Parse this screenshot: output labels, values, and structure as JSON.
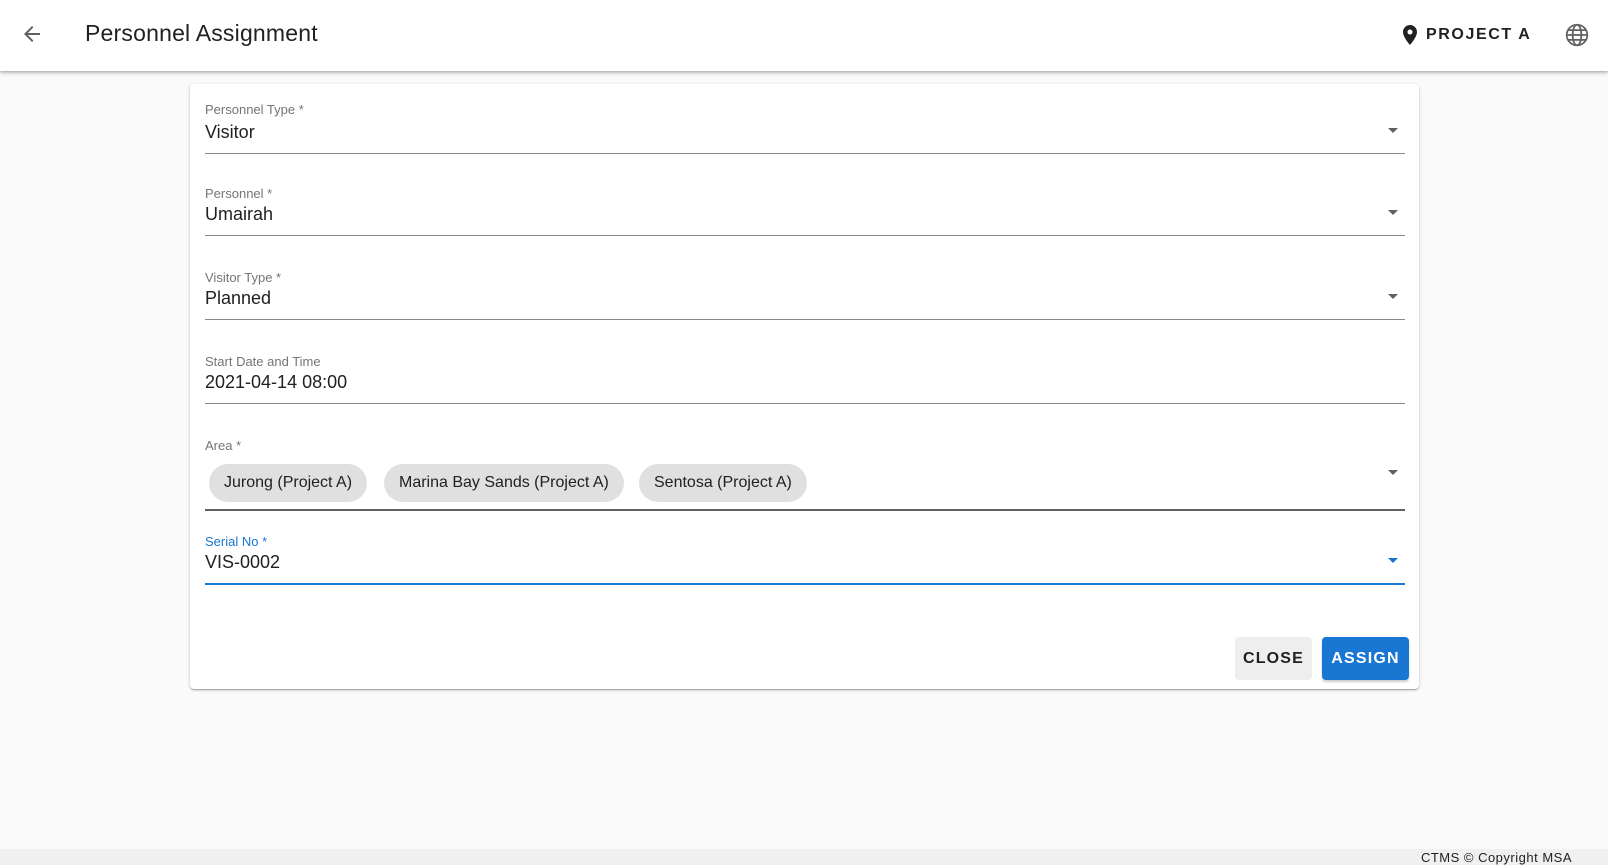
{
  "header": {
    "title": "Personnel Assignment",
    "project_label": "PROJECT A",
    "icons": {
      "back": "arrow-left-icon",
      "location": "map-pin-icon",
      "language": "globe-icon"
    }
  },
  "form": {
    "personnel_type": {
      "label": "Personnel Type *",
      "value": "Visitor"
    },
    "personnel": {
      "label": "Personnel *",
      "value": "Umairah"
    },
    "visitor_type": {
      "label": "Visitor Type *",
      "value": "Planned"
    },
    "start_datetime": {
      "label": "Start Date and Time",
      "value": "2021-04-14 08:00"
    },
    "area": {
      "label": "Area *",
      "chips": [
        "Jurong (Project A)",
        "Marina Bay Sands (Project A)",
        "Sentosa (Project A)"
      ]
    },
    "serial_no": {
      "label": "Serial No *",
      "value": "VIS-0002"
    }
  },
  "actions": {
    "close_label": "CLOSE",
    "assign_label": "ASSIGN"
  },
  "footer": {
    "copyright": "CTMS © Copyright MSA"
  },
  "colors": {
    "primary": "#1976d2",
    "chip_bg": "#e0e0e0",
    "background": "#fafafa"
  }
}
